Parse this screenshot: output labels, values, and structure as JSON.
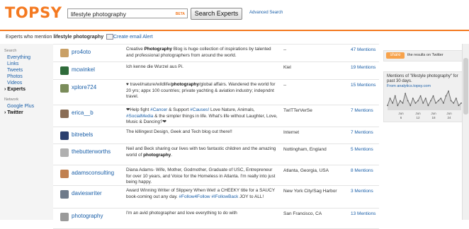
{
  "header": {
    "logo": "TOPSY",
    "search_value": "lifestyle photography",
    "beta": "BETA",
    "search_button": "Search Experts",
    "advanced_link": "Advanced Search"
  },
  "subbar": {
    "prefix": "Experts who mention ",
    "query": "lifestyle photography",
    "email_alert": "Create email Alert"
  },
  "sidebar": {
    "search_heading": "Search",
    "search_items": [
      "Everything",
      "Links",
      "Tweets",
      "Photos",
      "Videos"
    ],
    "experts_label": "Experts",
    "network_heading": "Network",
    "network_items": [
      "Google Plus"
    ],
    "twitter_label": "Twitter"
  },
  "results": [
    {
      "user": "pro4oto",
      "avatar_color": "#c9a066",
      "desc_html": "Creative <b>Photography</b> Blog is huge collection of inspirations by talented and professional photographers from around the world.",
      "location": "--",
      "mentions": "47 Mentions"
    },
    {
      "user": "mcwinkel",
      "avatar_color": "#2f6b3a",
      "desc_html": "Ich kenne die Wurzel aus Pi.",
      "location": "Kiel",
      "mentions": "19 Mentions"
    },
    {
      "user": "xplore724",
      "avatar_color": "#7a8c5a",
      "desc_html": "♥ travel/nature/wildlife/<b>photography</b>/global affairs. Wandered the world for 20 yrs; appx 100 countries; private yachting &amp; aviation industry; indepndnt travel.",
      "location": "--",
      "mentions": "15 Mentions"
    },
    {
      "user": "erica__b",
      "avatar_color": "#8a6d55",
      "desc_html": "❤Help fight <span class=\"tag\">#Cancer</span> &amp; Support <span class=\"tag\">#Causes!</span> Love Nature, Animals, <span class=\"tag\">#SocialMedia</span> &amp; the simpler things in life. What's life without Laughter, Love, Music &amp; Dancing?❤",
      "location": "TwITTerVerSe",
      "mentions": "7 Mentions"
    },
    {
      "user": "bitrebels",
      "avatar_color": "#2b3f6e",
      "desc_html": "The killingest Design, Geek and Tech blog out there!!",
      "location": "Internet",
      "mentions": "7 Mentions"
    },
    {
      "user": "thebutterworths",
      "avatar_color": "#b0b0b0",
      "desc_html": "Neil and Beck sharing our lives with two fantastic children and the amazing world of <b>photography</b>.",
      "location": "Nottingham, England",
      "mentions": "5 Mentions"
    },
    {
      "user": "adamsconsulting",
      "avatar_color": "#c08050",
      "desc_html": "Diana Adams- Wife, Mother, Godmother, Graduate of USC, Entrepreneur for over 10 years, and Voice for the Homeless in Atlanta. I'm really into just being happy.",
      "location": "Atlanta, Georgia, USA",
      "mentions": "8 Mentions"
    },
    {
      "user": "davieswriter",
      "avatar_color": "#6e7a8a",
      "desc_html": "Award Winning Writer of Slippery When Wet! a CHEEKY title for a SAUCY book-coming out any day. <span class=\"tag\">#Follow4Follow</span> <span class=\"tag\">#IFollowBack</span> JOY to ALL!",
      "location": "New York City/Sag Harbor",
      "mentions": "3 Mentions"
    },
    {
      "user": "photography",
      "avatar_color": "#9a9a9a",
      "desc_html": "I'm an avid photographer and love everything to do with",
      "location": "San Francisco, CA",
      "mentions": "13 Mentions"
    }
  ],
  "right": {
    "share_button": "share",
    "share_text": "the results on Twitter",
    "chart_title": "Mentions of \"lifestyle photography\" for past 30 days.",
    "chart_source": "From analytics.topsy.com",
    "x_ticks": [
      "Jun 6",
      "Jun 12",
      "Jun 18",
      "Jun 24"
    ]
  },
  "chart_data": {
    "type": "line",
    "title": "Mentions of \"lifestyle photography\" for past 30 days.",
    "x_ticks": [
      "Jun 6",
      "Jun 12",
      "Jun 18",
      "Jun 24"
    ],
    "values": [
      2,
      5,
      3,
      6,
      2,
      4,
      3,
      7,
      4,
      2,
      5,
      3,
      4,
      6,
      3,
      5,
      2,
      4,
      6,
      3,
      4,
      5,
      3,
      6,
      8,
      4,
      3,
      5,
      2,
      3
    ]
  }
}
